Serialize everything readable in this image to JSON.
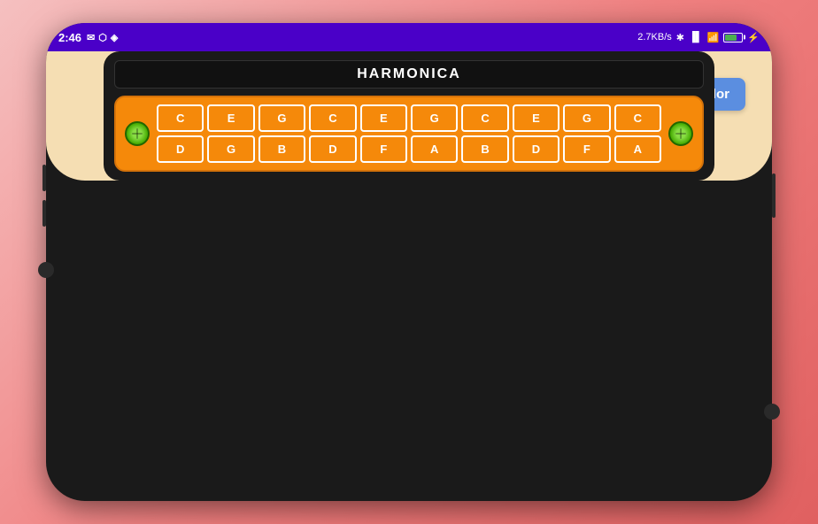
{
  "status_bar": {
    "time": "2:46",
    "network_speed": "2.7KB/s",
    "battery_percent": 70
  },
  "choose_color_button": {
    "label": "Choose Color"
  },
  "harmonica": {
    "title": "HARMONICA",
    "top_row": [
      "C",
      "E",
      "G",
      "C",
      "E",
      "G",
      "C",
      "E",
      "G",
      "C"
    ],
    "bottom_row": [
      "D",
      "G",
      "B",
      "D",
      "F",
      "A",
      "B",
      "D",
      "F",
      "A"
    ]
  }
}
